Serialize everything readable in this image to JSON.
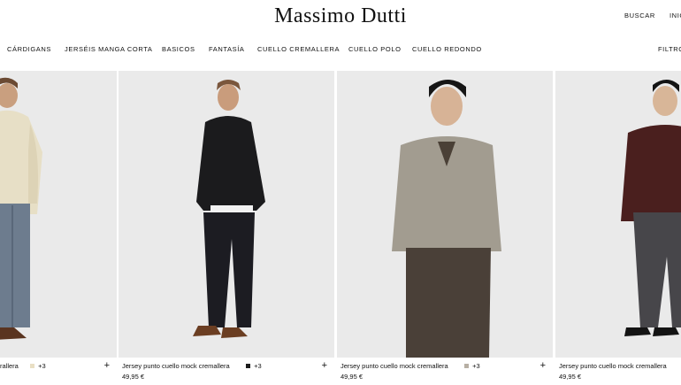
{
  "header": {
    "logo": "Massimo Dutti",
    "search_label": "BUSCAR",
    "login_label": "INIC"
  },
  "categories": {
    "items": [
      "CÁRDIGANS",
      "JERSÉIS MANGA CORTA",
      "BASICOS",
      "FANTASÍA",
      "CUELLO CREMALLERA",
      "CUELLO POLO",
      "CUELLO REDONDO"
    ],
    "filter_label": "FILTRO"
  },
  "products": [
    {
      "name": "rallera",
      "swatch_color": "#e9dfc4",
      "more": "+3",
      "price": ""
    },
    {
      "name": "Jersey punto cuello mock cremallera",
      "swatch_color": "#1c1c1c",
      "more": "+3",
      "price": "49,95 €"
    },
    {
      "name": "Jersey punto cuello mock cremallera",
      "swatch_color": "#b7afa4",
      "more": "+3",
      "price": "49,95 €"
    },
    {
      "name": "Jersey punto cuello mock cremallera",
      "swatch_color": "",
      "more": "",
      "price": "49,95 €"
    }
  ],
  "icons": {
    "add": "plus-icon"
  },
  "colors": {
    "background": "#ffffff",
    "photo_bg": "#eaeaea",
    "text": "#111111"
  }
}
